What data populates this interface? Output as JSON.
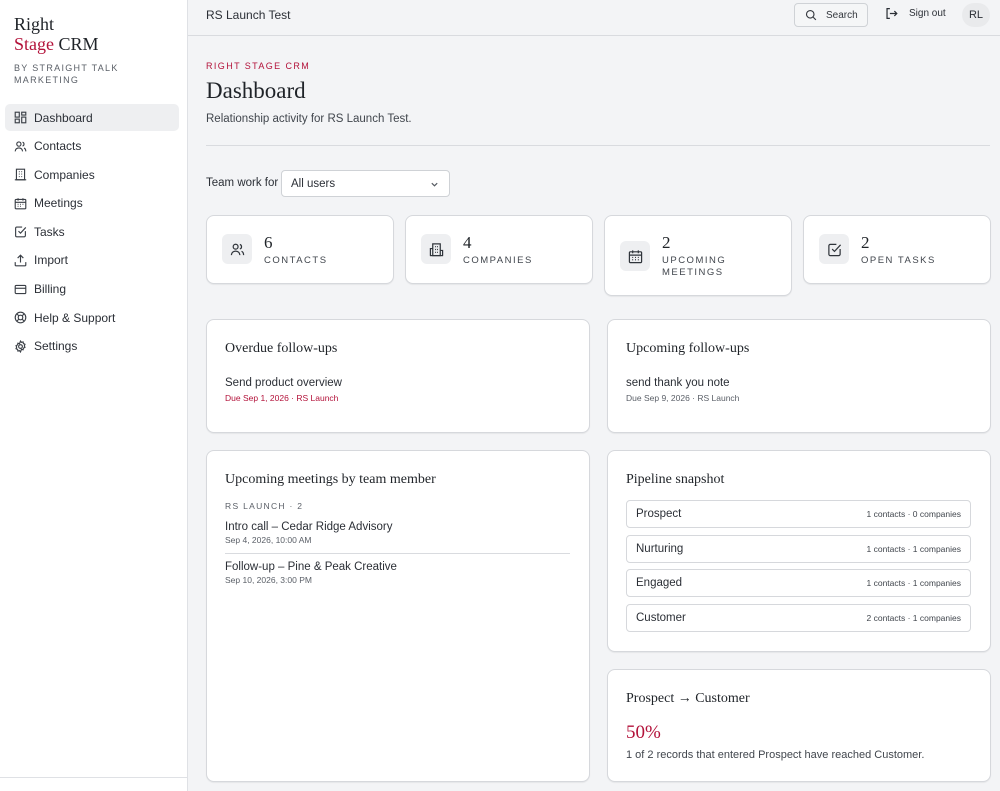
{
  "brand": {
    "name_line1": "Right",
    "name_accent": "Stage",
    "name_rest": " CRM",
    "byline": "BY STRAIGHT TALK MARKETING"
  },
  "sidebar": {
    "items": [
      {
        "label": "Dashboard",
        "icon": "dashboard-icon",
        "active": true
      },
      {
        "label": "Contacts",
        "icon": "contacts-icon"
      },
      {
        "label": "Companies",
        "icon": "companies-icon"
      },
      {
        "label": "Meetings",
        "icon": "calendar-icon"
      },
      {
        "label": "Tasks",
        "icon": "tasks-icon"
      },
      {
        "label": "Import",
        "icon": "upload-icon"
      },
      {
        "label": "Billing",
        "icon": "credit-card-icon"
      },
      {
        "label": "Help & Support",
        "icon": "lifebuoy-icon"
      },
      {
        "label": "Settings",
        "icon": "gear-icon"
      }
    ]
  },
  "topbar": {
    "title": "RS Launch Test",
    "search_label": "Search",
    "signout_label": "Sign out",
    "avatar_initials": "RL"
  },
  "header": {
    "eyebrow": "RIGHT STAGE CRM",
    "title": "Dashboard",
    "subtitle": "Relationship activity for RS Launch Test."
  },
  "filter": {
    "label": "Team work for",
    "selected": "All users"
  },
  "stats": [
    {
      "value": "6",
      "label": "CONTACTS",
      "icon": "contacts-icon"
    },
    {
      "value": "4",
      "label": "COMPANIES",
      "icon": "building-icon"
    },
    {
      "value": "2",
      "label": "UPCOMING MEETINGS",
      "icon": "calendar-icon"
    },
    {
      "value": "2",
      "label": "OPEN TASKS",
      "icon": "check-square-icon"
    }
  ],
  "overdue": {
    "title": "Overdue follow-ups",
    "items": [
      {
        "title": "Send product overview",
        "meta": "Due Sep 1, 2026 · RS Launch"
      }
    ]
  },
  "upcoming_followups": {
    "title": "Upcoming follow-ups",
    "items": [
      {
        "title": "send thank you note",
        "meta": "Due Sep 9, 2026 · RS Launch"
      }
    ]
  },
  "meetings": {
    "title": "Upcoming meetings by team member",
    "group_label": "RS LAUNCH · 2",
    "items": [
      {
        "title": "Intro call – Cedar Ridge Advisory",
        "time": "Sep 4, 2026, 10:00 AM"
      },
      {
        "title": "Follow-up – Pine & Peak Creative",
        "time": "Sep 10, 2026, 3:00 PM"
      }
    ]
  },
  "pipeline": {
    "title": "Pipeline snapshot",
    "stages": [
      {
        "name": "Prospect",
        "stats": "1 contacts · 0 companies"
      },
      {
        "name": "Nurturing",
        "stats": "1 contacts · 1 companies"
      },
      {
        "name": "Engaged",
        "stats": "1 contacts · 1 companies"
      },
      {
        "name": "Customer",
        "stats": "2 contacts · 1 companies"
      }
    ]
  },
  "conversion": {
    "title": "Prospect → Customer",
    "percent": "50%",
    "description": "1 of 2 records that entered Prospect have reached Customer."
  },
  "colors": {
    "accent": "#b3123a",
    "background": "#f3f4f6",
    "card": "#ffffff",
    "border": "#d6d8dc"
  }
}
